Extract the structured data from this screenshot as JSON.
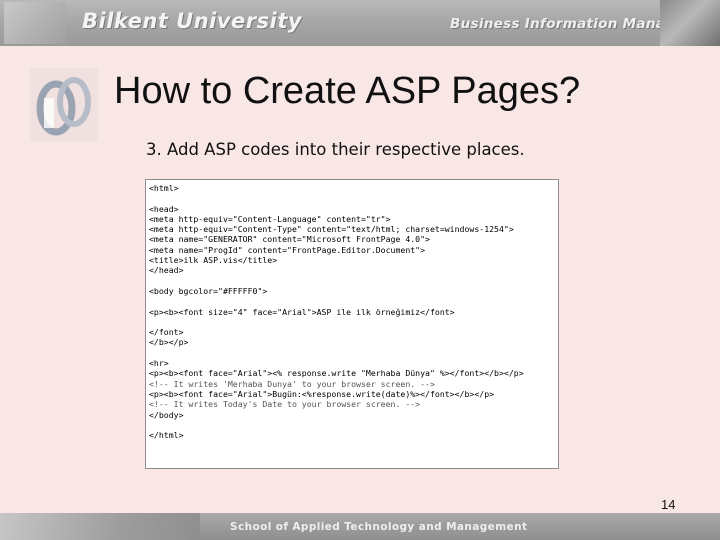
{
  "header": {
    "university": "Bilkent University",
    "department": "Business Information Management"
  },
  "slide": {
    "title": "How to Create ASP Pages?",
    "subtitle": "3. Add ASP codes into their respective places.",
    "code_lines": [
      "<html>",
      "",
      "<head>",
      "<meta http-equiv=\"Content-Language\" content=\"tr\">",
      "<meta http-equiv=\"Content-Type\" content=\"text/html; charset=windows-1254\">",
      "<meta name=\"GENERATOR\" content=\"Microsoft FrontPage 4.0\">",
      "<meta name=\"ProgId\" content=\"FrontPage.Editor.Document\">",
      "<title>ilk ASP.vis</title>",
      "</head>",
      "",
      "<body bgcolor=\"#FFFFF0\">",
      "",
      "<p><b><font size=\"4\" face=\"Arial\">ASP ile ilk örneğimiz</font>",
      "",
      "</font>",
      "</b></p>",
      "",
      "<hr>",
      "<p><b><font face=\"Arial\"><% response.write \"Merhaba Dünya\" %></font></b></p>",
      "<!-- It writes 'Merhaba Dunya' to your browser screen. -->",
      "<p><b><font face=\"Arial\">Bugün:<%response.write(date)%></font></b></p>",
      "<!-- It writes Today's Date to your browser screen. -->",
      "</body>",
      "",
      "</html>"
    ],
    "page_number": "14"
  },
  "footer": {
    "school": "School of Applied Technology and Management"
  }
}
